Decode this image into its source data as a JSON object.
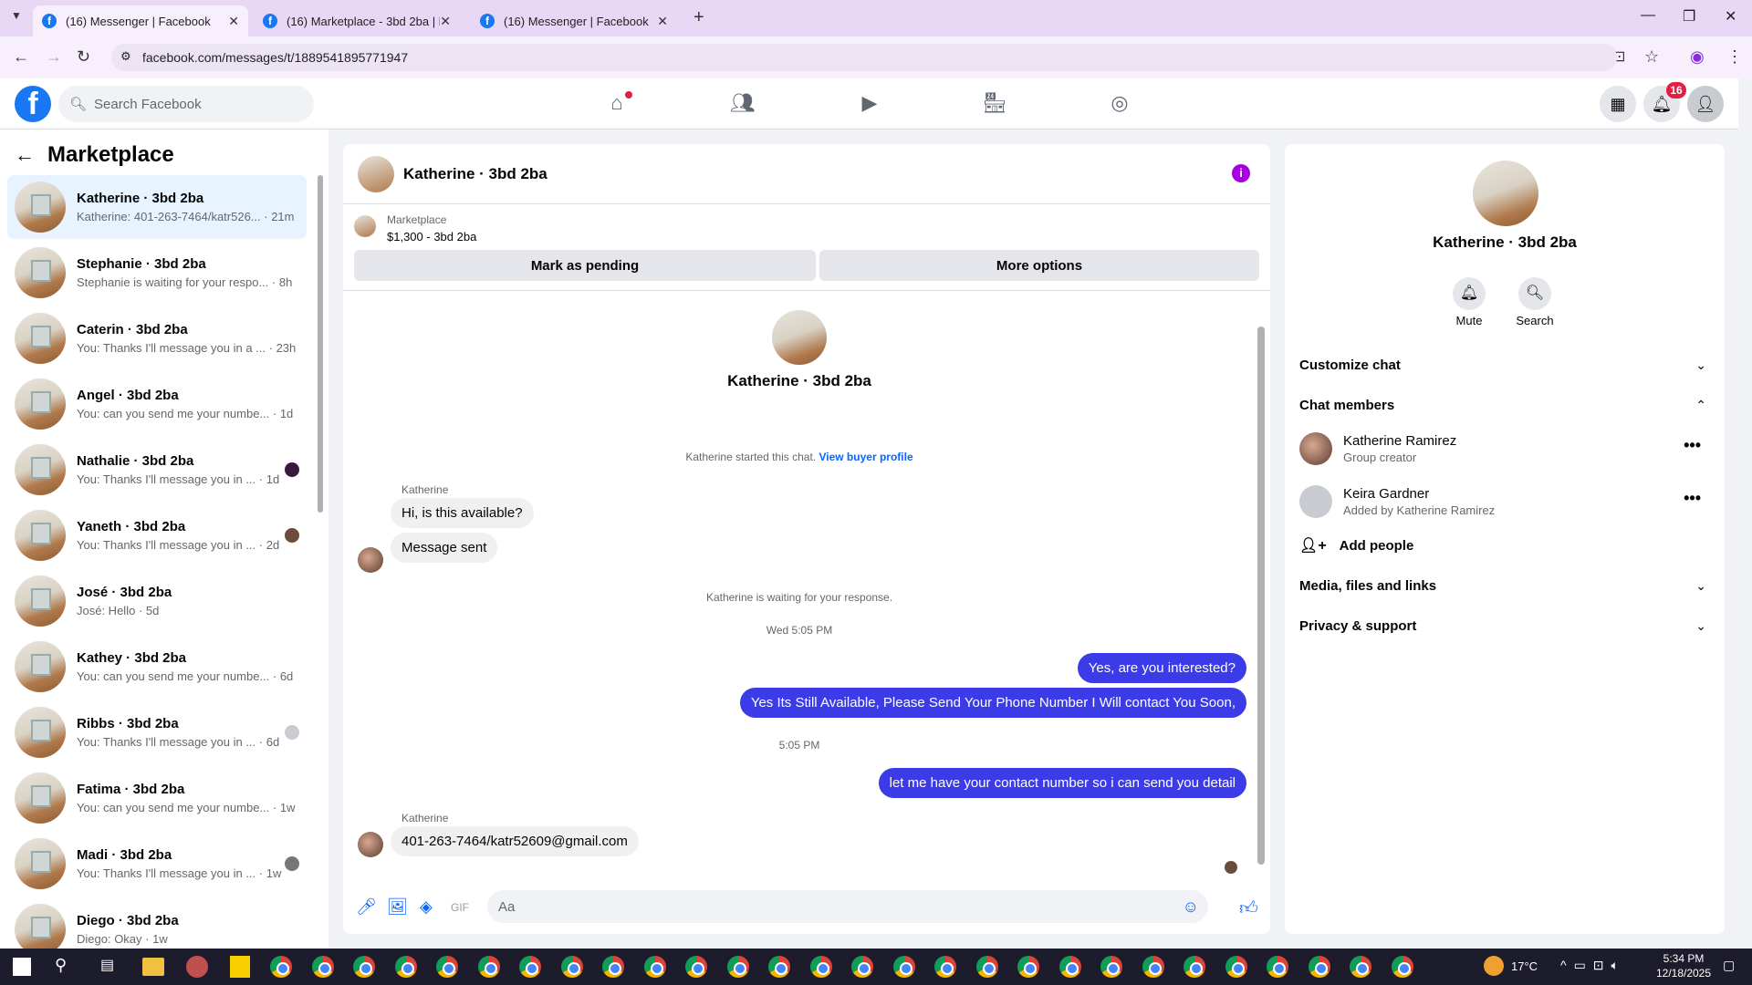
{
  "browser": {
    "tabs": [
      {
        "title": "(16) Messenger | Facebook"
      },
      {
        "title": "(16) Marketplace - 3bd 2ba | Fa"
      },
      {
        "title": "(16) Messenger | Facebook"
      }
    ],
    "url": "facebook.com/messages/t/1889541895771947"
  },
  "header": {
    "search_placeholder": "Search Facebook",
    "notification_count": "16"
  },
  "sidebar": {
    "title": "Marketplace",
    "conversations": [
      {
        "title": "Katherine · 3bd 2ba",
        "preview": "Katherine: 401-263-7464/katr526...",
        "time": "· 21m"
      },
      {
        "title": "Stephanie · 3bd 2ba",
        "preview": "Stephanie is waiting for your respo...",
        "time": "· 8h"
      },
      {
        "title": "Caterin · 3bd 2ba",
        "preview": "You: Thanks I'll message you in a ...",
        "time": "· 23h"
      },
      {
        "title": "Angel · 3bd 2ba",
        "preview": "You: can you send me your numbe...",
        "time": "· 1d"
      },
      {
        "title": "Nathalie · 3bd 2ba",
        "preview": "You: Thanks I'll message you in ...",
        "time": "· 1d"
      },
      {
        "title": "Yaneth · 3bd 2ba",
        "preview": "You: Thanks I'll message you in ...",
        "time": "· 2d"
      },
      {
        "title": "José · 3bd 2ba",
        "preview": "José: Hello",
        "time": "· 5d"
      },
      {
        "title": "Kathey · 3bd 2ba",
        "preview": "You: can you send me your numbe...",
        "time": "· 6d"
      },
      {
        "title": "Ribbs · 3bd 2ba",
        "preview": "You: Thanks I'll message you in ...",
        "time": "· 6d"
      },
      {
        "title": "Fatima · 3bd 2ba",
        "preview": "You: can you send me your numbe...",
        "time": "· 1w"
      },
      {
        "title": "Madi · 3bd 2ba",
        "preview": "You: Thanks I'll message you in ...",
        "time": "· 1w"
      },
      {
        "title": "Diego · 3bd 2ba",
        "preview": "Diego: Okay",
        "time": "· 1w"
      }
    ]
  },
  "chat": {
    "title": "Katherine · 3bd 2ba",
    "listing_label": "Marketplace",
    "listing_price": "$1,300 - 3bd 2ba",
    "mark_pending": "Mark as pending",
    "more_options": "More options",
    "profile_name": "Katherine · 3bd 2ba",
    "started_text": "Katherine started this chat.",
    "view_buyer": "View buyer profile",
    "sender1": "Katherine",
    "msg1": "Hi, is this available?",
    "msg2": "Message sent",
    "waiting": "Katherine is waiting for your response.",
    "time1": "Wed 5:05 PM",
    "out1": "Yes, are you interested?",
    "out2": "Yes Its Still Available, Please Send Your Phone Number I Will contact You Soon,",
    "time2": "5:05 PM",
    "out3": "let me have your contact number so i can send you detail",
    "sender2": "Katherine",
    "msg3": "401-263-7464/katr52609@gmail.com",
    "composer_placeholder": "Aa"
  },
  "details": {
    "name": "Katherine · 3bd 2ba",
    "mute": "Mute",
    "search": "Search",
    "customize": "Customize chat",
    "members_label": "Chat members",
    "members": [
      {
        "name": "Katherine Ramirez",
        "sub": "Group creator"
      },
      {
        "name": "Keira Gardner",
        "sub": "Added by Katherine Ramirez"
      }
    ],
    "add_people": "Add people",
    "media": "Media, files and links",
    "privacy": "Privacy & support"
  },
  "taskbar": {
    "temp": "17°C",
    "time": "5:34 PM",
    "date": "12/18/2025"
  }
}
